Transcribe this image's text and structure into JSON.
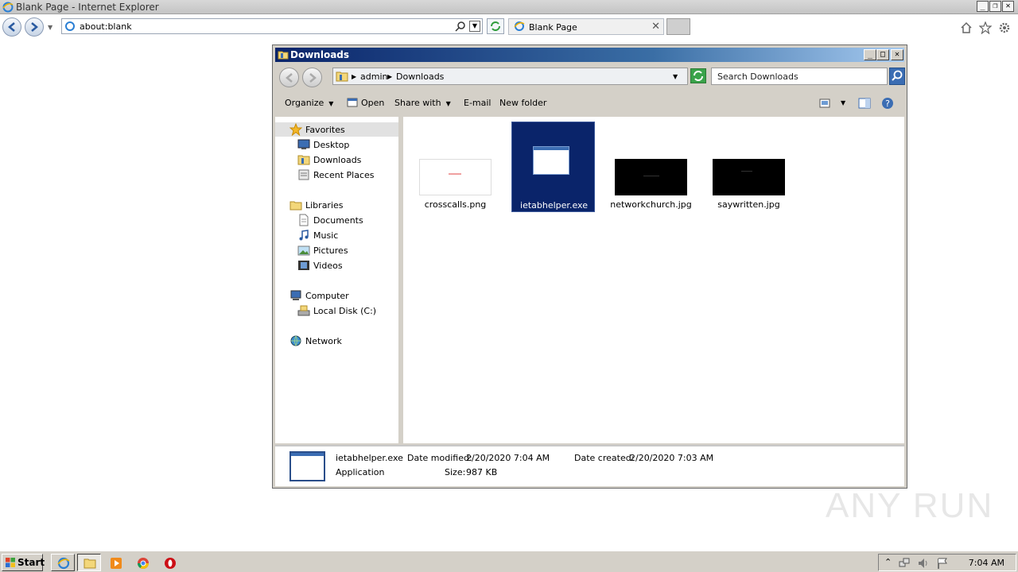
{
  "ie": {
    "window_title": "Blank Page - Internet Explorer",
    "address": "about:blank",
    "tab_label": "Blank Page",
    "tab_close": "✕",
    "controls": {
      "min": "_",
      "restore": "❐",
      "close": "✕"
    }
  },
  "explorer": {
    "window_title": "Downloads",
    "controls": {
      "min": "_",
      "max": "□",
      "close": "✕"
    },
    "breadcrumb": [
      "admin",
      "Downloads"
    ],
    "search_placeholder": "Search Downloads",
    "toolbar": {
      "organize": "Organize",
      "open": "Open",
      "share_with": "Share with",
      "email": "E-mail",
      "new_folder": "New folder"
    },
    "nav": {
      "favorites": "Favorites",
      "desktop": "Desktop",
      "downloads": "Downloads",
      "recent_places": "Recent Places",
      "libraries": "Libraries",
      "documents": "Documents",
      "music": "Music",
      "pictures": "Pictures",
      "videos": "Videos",
      "computer": "Computer",
      "local_disk": "Local Disk (C:)",
      "network": "Network"
    },
    "files": [
      {
        "name": "crosscalls.png",
        "selected": false,
        "thumb": "white"
      },
      {
        "name": "ietabhelper.exe",
        "selected": true,
        "thumb": "app"
      },
      {
        "name": "networkchurch.jpg",
        "selected": false,
        "thumb": "black"
      },
      {
        "name": "saywritten.jpg",
        "selected": false,
        "thumb": "black"
      }
    ],
    "details": {
      "name": "ietabhelper.exe",
      "type": "Application",
      "modified_label": "Date modified:",
      "modified_value": "2/20/2020 7:04 AM",
      "created_label": "Date created:",
      "created_value": "2/20/2020 7:03 AM",
      "size_label": "Size:",
      "size_value": "987 KB"
    }
  },
  "taskbar": {
    "start": "Start",
    "clock": "7:04 AM"
  },
  "watermark": "ANY RUN",
  "colors": {
    "selection": "#0a246a",
    "title_gradient_start": "#0a246a"
  }
}
